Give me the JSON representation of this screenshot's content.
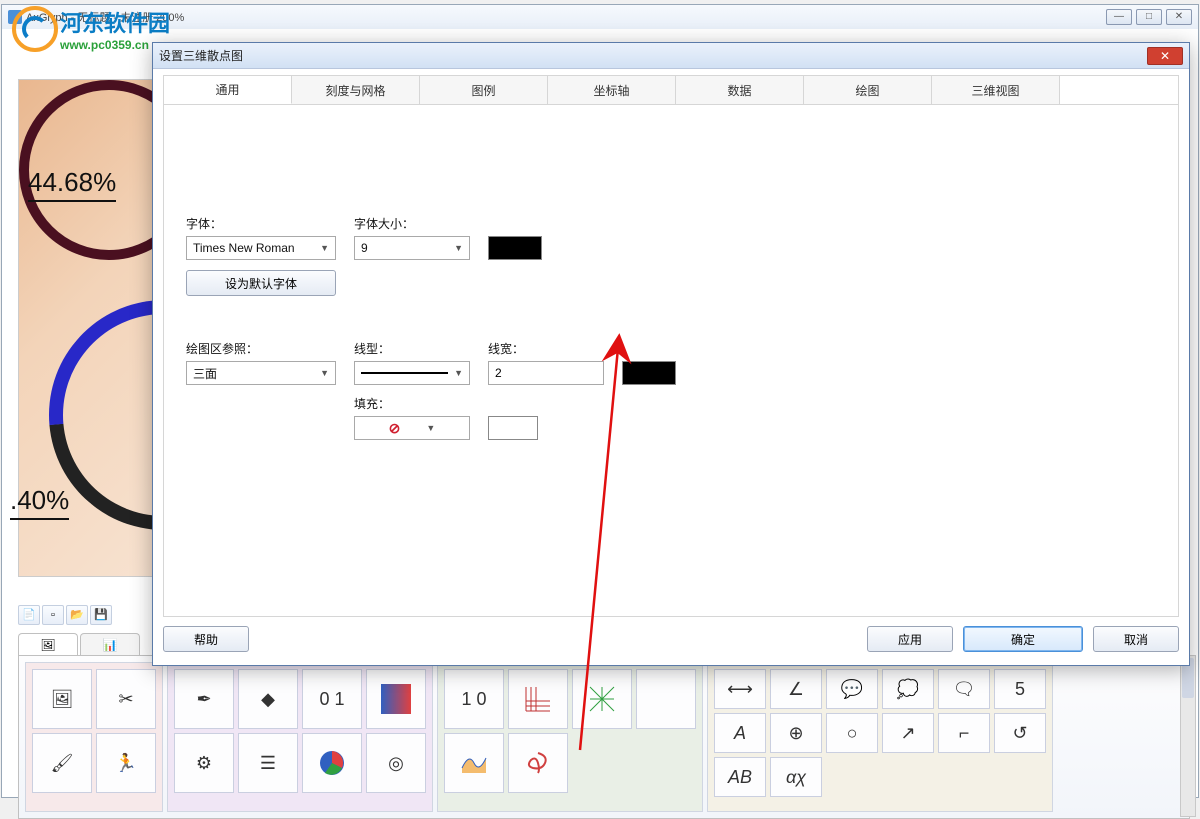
{
  "app": {
    "title": "AxGlyph - 无标题 - 未注册   200%",
    "window_buttons": {
      "min": "—",
      "max": "□",
      "close": "✕"
    }
  },
  "watermark": {
    "cn": "河东软件园",
    "en": "www.pc0359.cn"
  },
  "canvas": {
    "pct1": "44.68%",
    "pct2": ".40%"
  },
  "dialog": {
    "title": "设置三维散点图",
    "tabs": [
      "通用",
      "刻度与网格",
      "图例",
      "坐标轴",
      "数据",
      "绘图",
      "三维视图"
    ],
    "active_tab": 0,
    "general": {
      "font_label": "字体：",
      "font_value": "Times New Roman",
      "font_size_label": "字体大小：",
      "font_size_value": "9",
      "set_default_font": "设为默认字体",
      "plot_ref_label": "绘图区参照：",
      "plot_ref_value": "三面",
      "line_type_label": "线型：",
      "line_width_label": "线宽：",
      "line_width_value": "2",
      "fill_label": "填充："
    },
    "footer": {
      "help": "帮助",
      "apply": "应用",
      "ok": "确定",
      "cancel": "取消"
    }
  },
  "palette": {
    "matrix": "0 1",
    "tensor": "1 0",
    "num5": "5",
    "letA": "A",
    "letAB": "AB",
    "alpha": "αχ"
  }
}
